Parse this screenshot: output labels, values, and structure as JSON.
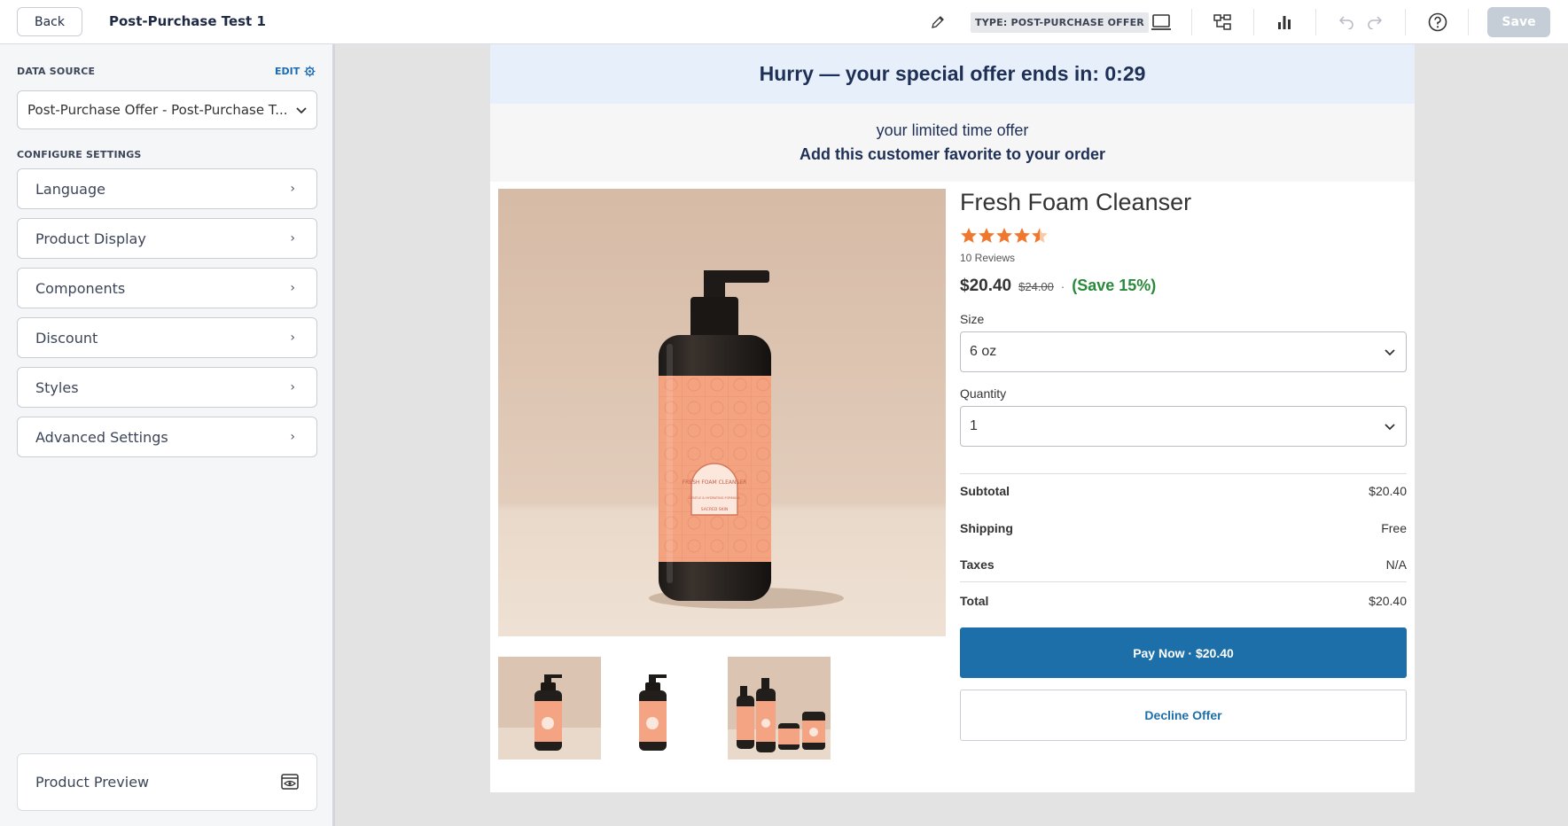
{
  "header": {
    "back_label": "Back",
    "title": "Post-Purchase Test 1",
    "type_badge": "TYPE: POST-PURCHASE OFFER",
    "save_label": "Save",
    "icons": [
      "pencil-icon",
      "laptop-icon",
      "flow-icon",
      "bar-chart-icon",
      "undo-icon",
      "redo-icon",
      "help-icon"
    ]
  },
  "sidebar": {
    "data_source_label": "DATA SOURCE",
    "edit_label": "EDIT",
    "data_source_value": "Post-Purchase Offer - Post-Purchase T...",
    "configure_label": "CONFIGURE SETTINGS",
    "items": [
      {
        "label": "Language"
      },
      {
        "label": "Product Display"
      },
      {
        "label": "Components"
      },
      {
        "label": "Discount"
      },
      {
        "label": "Styles"
      },
      {
        "label": "Advanced Settings"
      }
    ],
    "preview_label": "Product Preview"
  },
  "offer": {
    "countdown_text": "Hurry — your special offer ends in: 0:29",
    "subtitle": "your limited time offer",
    "title": "Add this customer favorite to your order",
    "product_name": "Fresh Foam Cleanser",
    "rating": 4.5,
    "reviews": "10 Reviews",
    "price": "$20.40",
    "original_price": "$24.00",
    "separator": "·",
    "savings": "(Save 15%)",
    "size_label": "Size",
    "size_value": "6 oz",
    "quantity_label": "Quantity",
    "quantity_value": "1",
    "summary": [
      {
        "label": "Subtotal",
        "value": "$20.40"
      },
      {
        "label": "Shipping",
        "value": "Free"
      },
      {
        "label": "Taxes",
        "value": "N/A"
      },
      {
        "label": "Total",
        "value": "$20.40"
      }
    ],
    "pay_label": "Pay Now · $20.40",
    "decline_label": "Decline Offer",
    "label_text": "FRESH FOAM CLEANSER",
    "label_small": "GENTLE & HYDRATING FORMULA",
    "label_brand": "SACRED SKIN"
  },
  "colors": {
    "accent": "#1d6fa9",
    "savings": "#2a8a3a",
    "stars": "#f0772d",
    "banner": "#e7f0fa"
  }
}
